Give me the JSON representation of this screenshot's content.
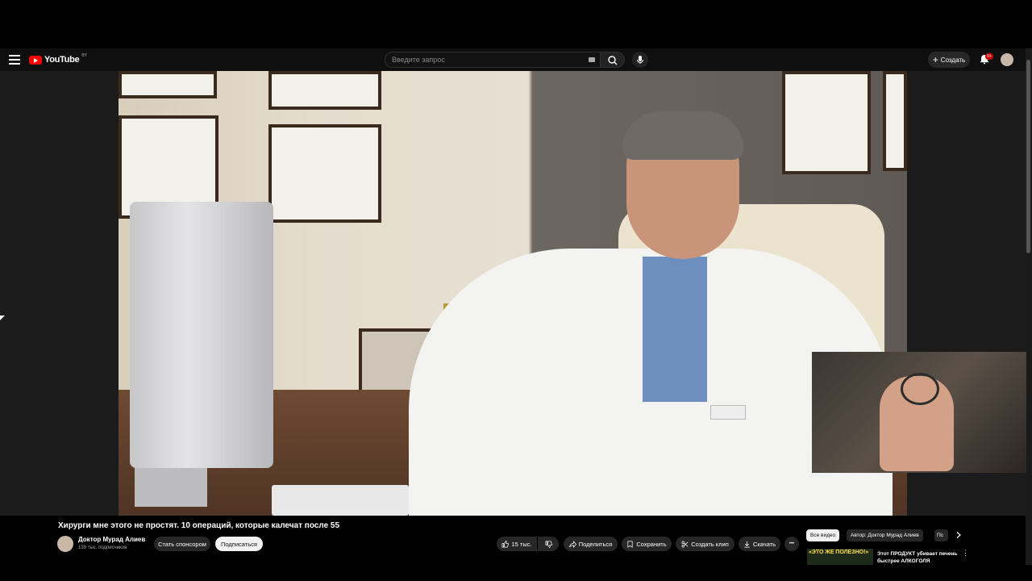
{
  "masthead": {
    "logo_text": "YouTube",
    "logo_country": "BY",
    "search_placeholder": "Введите запрос",
    "create_label": "Создать",
    "notifications_badge": "9+"
  },
  "video": {
    "title": "Хирурги мне этого не простят. 10 операций, которые калечат после 55"
  },
  "channel": {
    "name": "Доктор Мурад Алиев",
    "subscribers": "139 тыс. подписчиков",
    "sponsor_label": "Стать спонсором",
    "subscribe_label": "Подписаться"
  },
  "actions": {
    "likes": "15 тыс.",
    "share_label": "Поделиться",
    "save_label": "Сохранить",
    "clip_label": "Создать клип",
    "download_label": "Скачать",
    "more_label": "•••"
  },
  "chips": {
    "items": [
      "Все видео",
      "Автор: Доктор Мурад Алиев",
      "Пс"
    ],
    "active_index": 0
  },
  "recommendation": {
    "thumb_text": "«ЭТО ЖЕ ПОЛЕЗНО!»",
    "title": "Этот ПРОДУКТ убивает печень быстрее АЛКОГОЛЯ"
  },
  "colors": {
    "background": "#0f0f0f",
    "brand_red": "#ff0000",
    "chip_active": "#f1f1f1",
    "button_dark": "#272727"
  },
  "icons": [
    "menu-icon",
    "youtube-logo-icon",
    "keyboard-icon",
    "search-icon",
    "mic-icon",
    "plus-icon",
    "bell-icon",
    "like-icon",
    "dislike-icon",
    "share-icon",
    "save-icon",
    "scissors-icon",
    "download-icon",
    "chevron-right-icon",
    "kebab-icon"
  ]
}
